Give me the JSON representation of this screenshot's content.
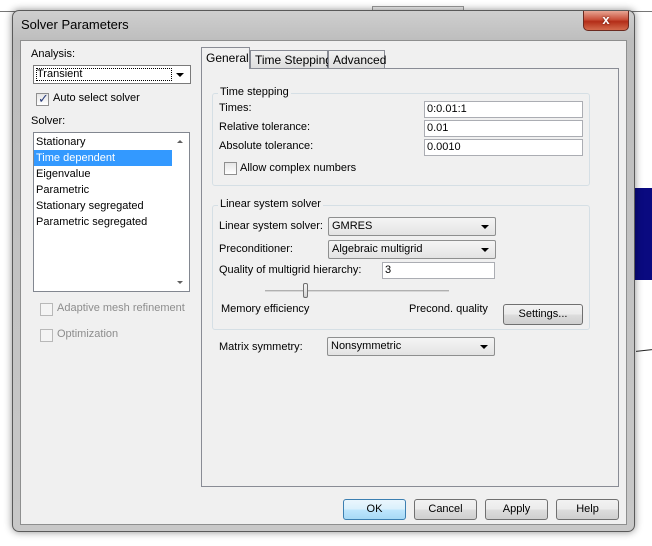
{
  "window": {
    "title": "Solver Parameters",
    "close_label": "x"
  },
  "left": {
    "analysis_label": "Analysis:",
    "analysis_value": "Transient",
    "auto_select_label": "Auto select solver",
    "auto_select_checked": true,
    "solver_label": "Solver:",
    "solver_items": [
      {
        "label": "Stationary",
        "selected": false
      },
      {
        "label": "Time dependent",
        "selected": true
      },
      {
        "label": "Eigenvalue",
        "selected": false
      },
      {
        "label": "Parametric",
        "selected": false
      },
      {
        "label": "Stationary segregated",
        "selected": false
      },
      {
        "label": "Parametric segregated",
        "selected": false
      }
    ],
    "adaptive_label": "Adaptive mesh refinement",
    "optimization_label": "Optimization"
  },
  "tabs": [
    {
      "label": "General",
      "active": true
    },
    {
      "label": "Time Stepping",
      "active": false
    },
    {
      "label": "Advanced",
      "active": false
    }
  ],
  "general": {
    "time_stepping": {
      "title": "Time stepping",
      "times_label": "Times:",
      "times_value": "0:0.01:1",
      "rel_tol_label": "Relative tolerance:",
      "rel_tol_value": "0.01",
      "abs_tol_label": "Absolute tolerance:",
      "abs_tol_value": "0.0010",
      "complex_label": "Allow complex numbers",
      "complex_checked": false
    },
    "linear": {
      "title": "Linear system solver",
      "solver_label": "Linear system solver:",
      "solver_value": "GMRES",
      "precond_label": "Preconditioner:",
      "precond_value": "Algebraic multigrid",
      "quality_label": "Quality of multigrid hierarchy:",
      "quality_value": "3",
      "slider_fraction": 0.22,
      "slider_min_label": "Memory efficiency",
      "slider_max_label": "Precond. quality",
      "settings_label": "Settings..."
    },
    "matrix_label": "Matrix symmetry:",
    "matrix_value": "Nonsymmetric"
  },
  "buttons": {
    "ok": "OK",
    "cancel": "Cancel",
    "apply": "Apply",
    "help": "Help"
  }
}
